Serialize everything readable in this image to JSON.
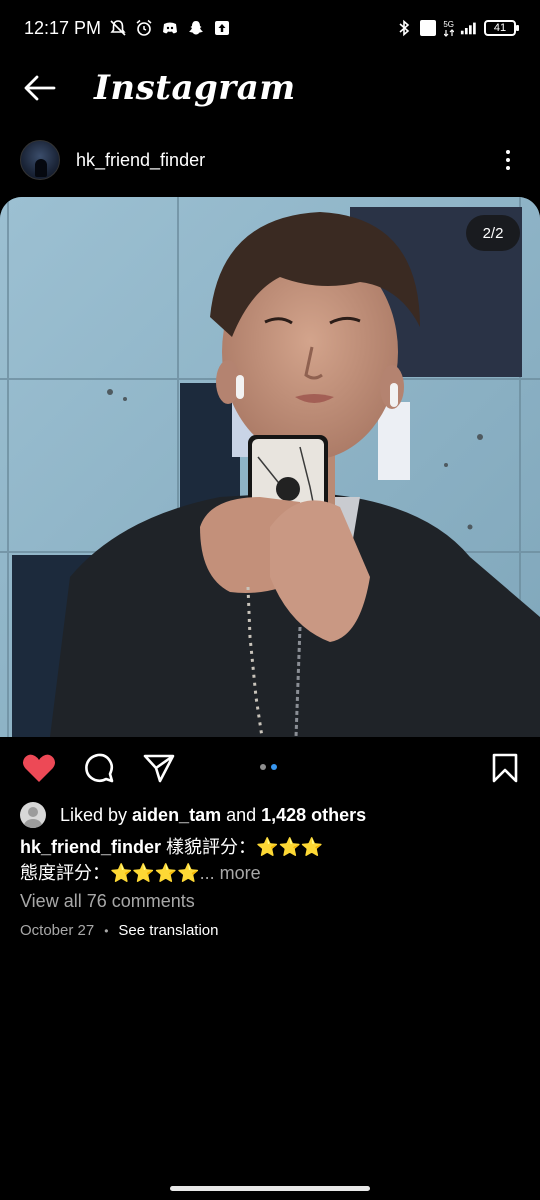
{
  "status_bar": {
    "time": "12:17 PM",
    "network_label_top": "5G",
    "volte_label": "Vo LTE",
    "battery": "41"
  },
  "header": {
    "brand": "Instagram"
  },
  "post": {
    "username": "hk_friend_finder",
    "page_indicator": "2/2",
    "carousel_total": 2,
    "carousel_current": 2
  },
  "engagement": {
    "liked_prefix": "Liked by ",
    "liker": "aiden_tam",
    "and_text": " and ",
    "others": "1,428 others",
    "liked": true
  },
  "caption": {
    "username": "hk_friend_finder",
    "line1_text": " 樣貌評分：⭐⭐⭐",
    "line2_text": "態度評分：⭐⭐⭐⭐",
    "ellipsis": "...",
    "more": " more"
  },
  "comments_link": "View all 76 comments",
  "date": "October 27",
  "separator": "•",
  "translate": "See translation",
  "colors": {
    "like": "#ed4956",
    "carousel_active": "#3897f0",
    "muted": "#a8a8a8",
    "background": "#000000"
  },
  "icons": [
    "back-arrow-icon",
    "more-vertical-icon",
    "heart-icon",
    "comment-icon",
    "share-icon",
    "bookmark-icon"
  ]
}
